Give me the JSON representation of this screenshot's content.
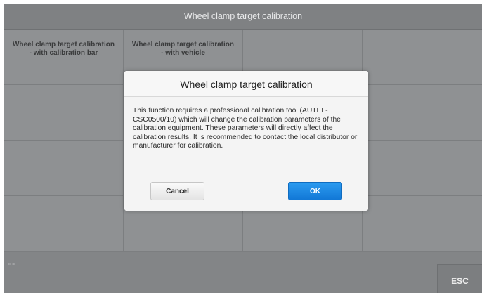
{
  "window": {
    "title": "Wheel clamp target calibration"
  },
  "grid": {
    "cells": [
      "Wheel clamp target calibration - with calibration bar",
      "Wheel clamp target calibration - with vehicle",
      "",
      "",
      "",
      "",
      "",
      "",
      "",
      "",
      "",
      "",
      "",
      "",
      "",
      ""
    ]
  },
  "status": {
    "tiny_text": "••• •••"
  },
  "esc": {
    "label": "ESC"
  },
  "dialog": {
    "title": "Wheel clamp target calibration",
    "message": "This function requires a professional calibration tool (AUTEL-CSC0500/10) which will change the calibration parameters of the calibration equipment. These parameters will directly affect the calibration results. It is recommended to contact the local distributor or manufacturer for calibration.",
    "cancel_label": "Cancel",
    "ok_label": "OK"
  },
  "colors": {
    "ok_button": "#1a85e3",
    "overlay_gray": "#8e9092",
    "dialog_bg": "#f4f4f4"
  }
}
